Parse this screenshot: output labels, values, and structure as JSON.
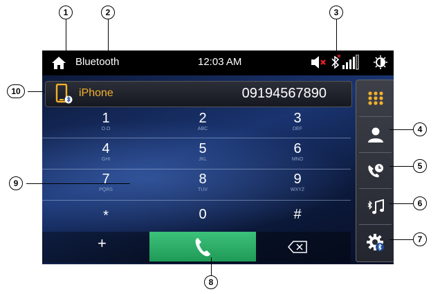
{
  "status_bar": {
    "source_label": "Bluetooth",
    "time": "12:03 AM",
    "icons": [
      "home-icon",
      "speaker-muted-icon",
      "bluetooth-icon",
      "signal-strength-icon",
      "brightness-icon"
    ]
  },
  "phone_bar": {
    "device_name": "iPhone",
    "dialed_number": "09194567890",
    "icon": "phone-bluetooth-icon"
  },
  "keypad": [
    {
      "digit": "1",
      "letters": "O.O"
    },
    {
      "digit": "2",
      "letters": "ABC"
    },
    {
      "digit": "3",
      "letters": "DEF"
    },
    {
      "digit": "4",
      "letters": "GHI"
    },
    {
      "digit": "5",
      "letters": "JKL"
    },
    {
      "digit": "6",
      "letters": "MNO"
    },
    {
      "digit": "7",
      "letters": "PQRS"
    },
    {
      "digit": "8",
      "letters": "TUV"
    },
    {
      "digit": "9",
      "letters": "WXYZ"
    },
    {
      "digit": "*",
      "letters": ""
    },
    {
      "digit": "0",
      "letters": ""
    },
    {
      "digit": "#",
      "letters": ""
    }
  ],
  "bottom_row": {
    "plus_label": "+",
    "call_icon": "call-icon",
    "backspace_icon": "backspace-icon"
  },
  "side_menu": [
    "keypad-icon",
    "contacts-icon",
    "call-history-icon",
    "bt-audio-icon",
    "bt-settings-icon"
  ],
  "callouts": [
    "1",
    "2",
    "3",
    "4",
    "5",
    "6",
    "7",
    "8",
    "9",
    "10"
  ],
  "colors": {
    "accent": "#f4b12c",
    "call_green": "#2db068",
    "background": "#10224c"
  }
}
